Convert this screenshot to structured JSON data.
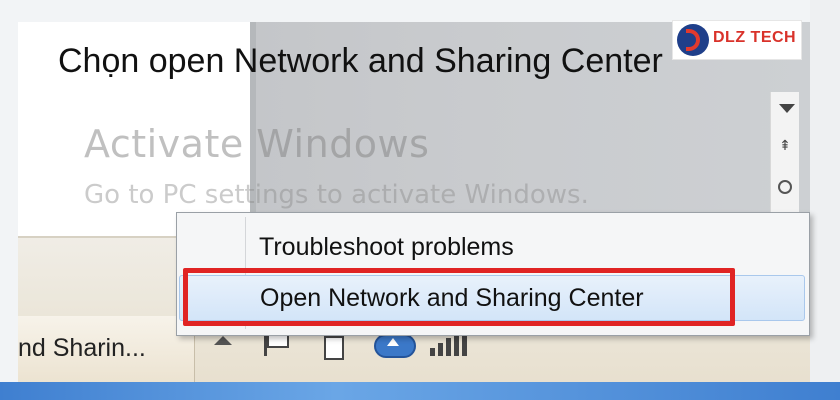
{
  "headline": "Chọn open Network and Sharing Center",
  "watermark": {
    "title": "Activate Windows",
    "subtitle": "Go to PC settings to activate Windows."
  },
  "taskbar": {
    "task_button_label": "nd Sharin..."
  },
  "context_menu": {
    "items": [
      {
        "label": "Troubleshoot problems",
        "highlighted": false
      },
      {
        "label": "Open Network and Sharing Center",
        "highlighted": true
      }
    ]
  },
  "tray_icons": [
    "show-hidden-icons-arrow",
    "action-center-flag-icon",
    "power-icon",
    "cloud-upload-icon",
    "network-signal-icon"
  ],
  "logo": {
    "text": "DLZ TECH"
  },
  "colors": {
    "highlight_border": "#e02424",
    "bottom_stripe": "#3f7fd0",
    "selected_item_bg": "#d3e5f8"
  }
}
